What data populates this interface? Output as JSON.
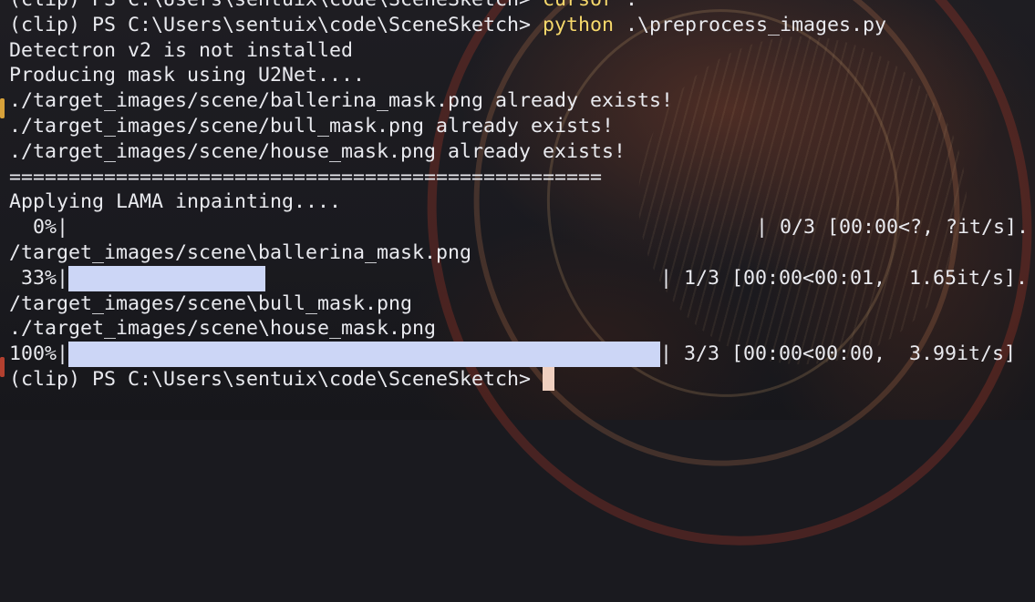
{
  "prompt": "(clip) PS C:\\Users\\sentuix\\code\\SceneSketch>",
  "top_partial_line": {
    "prompt": "(clip) PS C:\\Users\\sentuix\\code\\SceneSketch> ",
    "command": "cursor",
    "rest": " ."
  },
  "run_line": {
    "prompt": "(clip) PS C:\\Users\\sentuix\\code\\SceneSketch> ",
    "command": "python",
    "args": " .\\preprocess_images.py"
  },
  "output": {
    "l1": "Detectron v2 is not installed",
    "l2": "Producing mask using U2Net....",
    "l3": "./target_images/scene/ballerina_mask.png already exists!",
    "l4": "./target_images/scene/bull_mask.png already exists!",
    "l5": "./target_images/scene/house_mask.png already exists!",
    "separator": "==================================================",
    "l6": "Applying LAMA inpainting....",
    "p0_pct": "  0%|",
    "p0_stats": "| 0/3 [00:00<?, ?it/s].",
    "l7": "/target_images/scene\\ballerina_mask.png",
    "p1_pct": " 33%|",
    "p1_stats": "| 1/3 [00:00<00:01,  1.65it/s].",
    "l8": "/target_images/scene\\bull_mask.png",
    "l9": "./target_images/scene\\house_mask.png",
    "p2_pct": "100%|",
    "p2_stats": "| 3/3 [00:00<00:00,  3.99it/s]"
  },
  "progress": {
    "p0_fraction": 0.0,
    "p1_fraction": 0.333,
    "p2_fraction": 1.0
  },
  "colors": {
    "text": "#e9eaef",
    "command": "#f6d86b",
    "progress_bar": "#ccd6f6",
    "cursor": "#f0d0c0",
    "background": "#1a1a1f"
  },
  "icons": {
    "cursor": "block-cursor"
  }
}
